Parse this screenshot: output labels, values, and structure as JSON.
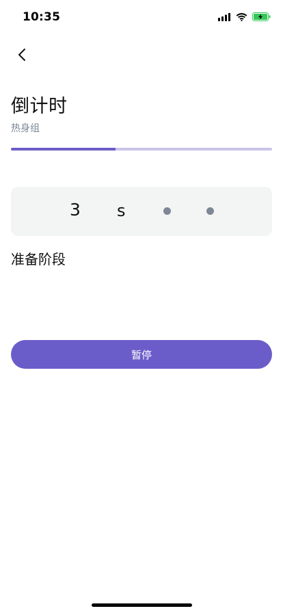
{
  "status_bar": {
    "time": "10:35",
    "icons": [
      "signal-icon",
      "wifi-icon",
      "battery-charging-icon"
    ],
    "battery_color": "#34c759"
  },
  "header": {
    "back_icon": "chevron-left-icon",
    "title": "倒计时",
    "subtitle": "热身组"
  },
  "progress": {
    "fraction": 0.4,
    "fill_color": "#6b5dc9",
    "track_color": "#c9c4e8"
  },
  "countdown": {
    "number": "3",
    "unit": "s",
    "dots": 2
  },
  "phase": {
    "label": "准备阶段"
  },
  "actions": {
    "pause_label": "暂停",
    "accent_color": "#6b5dc9"
  }
}
